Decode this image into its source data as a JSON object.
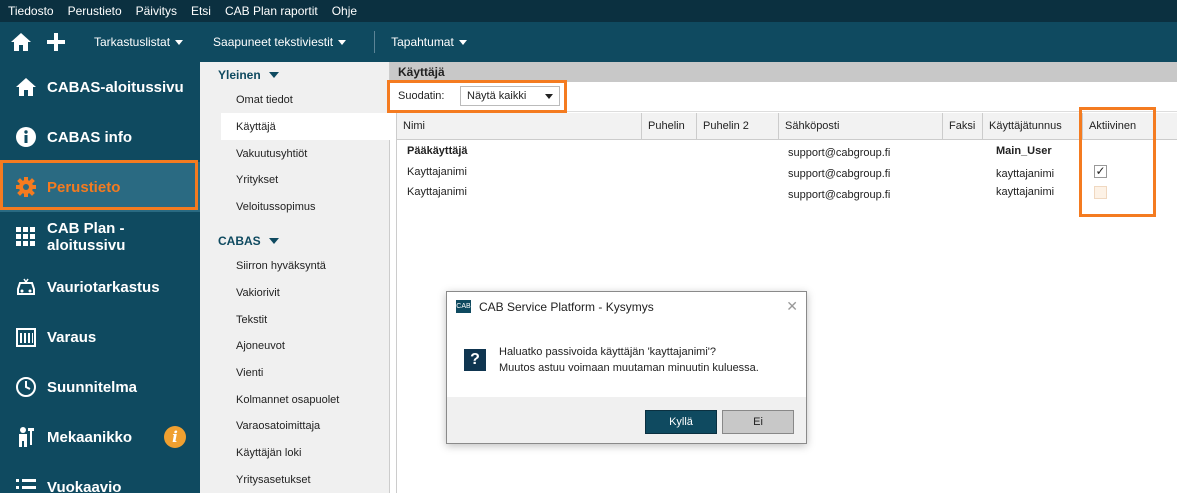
{
  "menu": [
    "Tiedosto",
    "Perustieto",
    "Päivitys",
    "Etsi",
    "CAB Plan raportit",
    "Ohje"
  ],
  "toolbar": {
    "dropdowns": [
      "Tarkastuslistat",
      "Saapuneet tekstiviestit",
      "Tapahtumat"
    ]
  },
  "sidebar": {
    "items": [
      {
        "label": "CABAS-aloitussivu",
        "icon": "home-icon"
      },
      {
        "label": "CABAS info",
        "icon": "info-circle-icon"
      },
      {
        "label": "Perustieto",
        "icon": "gear-icon",
        "active": true
      },
      {
        "label": "CAB Plan -aloitussivu",
        "icon": "grid-icon"
      },
      {
        "label": "Vauriotarkastus",
        "icon": "car-damage-icon"
      },
      {
        "label": "Varaus",
        "icon": "calendar-icon"
      },
      {
        "label": "Suunnitelma",
        "icon": "clock-icon"
      },
      {
        "label": "Mekaanikko",
        "icon": "mechanic-icon"
      },
      {
        "label": "Vuokaavio",
        "icon": "list-icon"
      }
    ]
  },
  "subnav": {
    "section1": "Yleinen",
    "items1": [
      "Omat tiedot",
      "Käyttäjä",
      "Vakuutusyhtiöt",
      "Yritykset",
      "Veloitussopimus"
    ],
    "section2": "CABAS",
    "items2": [
      "Siirron hyväksyntä",
      "Vakiorivit",
      "Tekstit",
      "Ajoneuvot",
      "Vienti",
      "Kolmannet osapuolet",
      "Varaosatoimittaja",
      "Käyttäjän loki",
      "Yritysasetukset"
    ]
  },
  "main": {
    "title": "Käyttäjä",
    "filter_label": "Suodatin:",
    "filter_value": "Näytä kaikki",
    "columns": [
      "Nimi",
      "Puhelin",
      "Puhelin 2",
      "Sähköposti",
      "Faksi",
      "Käyttäjätunnus",
      "Aktiivinen"
    ],
    "rows": [
      {
        "name": "Pääkäyttäjä",
        "email": "support@cabgroup.fi",
        "username": "Main_User",
        "active": null,
        "bold": true
      },
      {
        "name": "Kayttajanimi",
        "email": "support@cabgroup.fi",
        "username": "kayttajanimi",
        "active": true,
        "bold": false
      },
      {
        "name": "Kayttajanimi",
        "email": "support@cabgroup.fi",
        "username": "kayttajanimi",
        "active": false,
        "bold": false
      }
    ]
  },
  "dialog": {
    "title": "CAB Service Platform - Kysymys",
    "message1": "Haluatko passivoida käyttäjän 'kayttajanimi'?",
    "message2": "Muutos astuu voimaan muutaman minuutin kuluessa.",
    "yes_label": "Kyllä",
    "no_label": "Ei"
  },
  "colors": {
    "accent": "#f47b20",
    "nav": "#0f4a60",
    "menubar": "#0b3040"
  }
}
